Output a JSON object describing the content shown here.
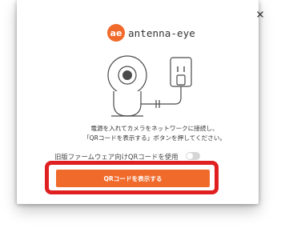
{
  "dialog": {
    "brand": {
      "logo_text": "ae",
      "name": "antenna-eye"
    },
    "description_line1": "電源を入れてカメラをネットワークに接続し、",
    "description_line2": "「QRコードを表示する」ボタンを押してください。",
    "legacy_option_label": "旧版ファームウェア向けQRコードを使用",
    "legacy_toggle_on": false,
    "primary_button_label": "QRコードを表示する",
    "icons": {
      "close": "close-icon",
      "camera": "camera-illustration-icon",
      "outlet": "power-outlet-icon"
    }
  },
  "colors": {
    "accent": "#f06a2b",
    "highlight": "#e02020",
    "text": "#333333"
  }
}
